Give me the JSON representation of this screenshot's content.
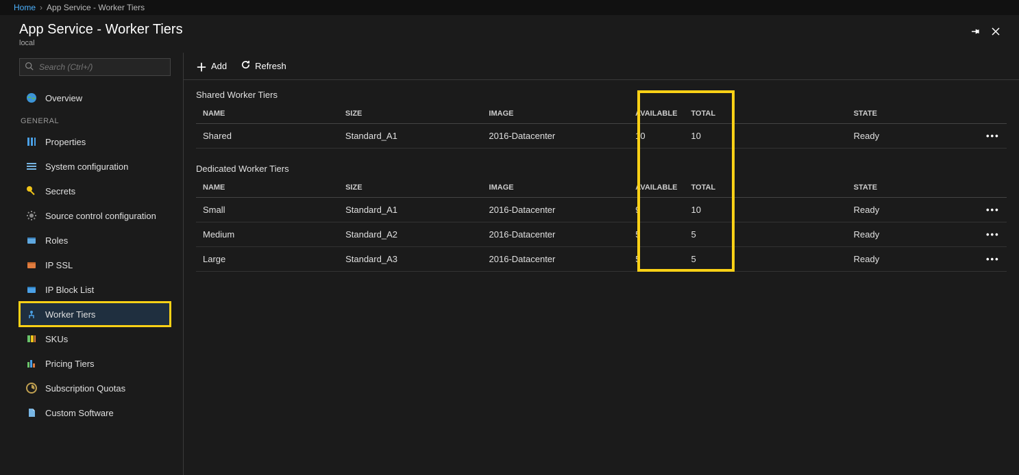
{
  "breadcrumb": {
    "home": "Home",
    "current": "App Service - Worker Tiers"
  },
  "page": {
    "title": "App Service - Worker Tiers",
    "subtitle": "local"
  },
  "search": {
    "placeholder": "Search (Ctrl+/)"
  },
  "nav": {
    "overview": "Overview",
    "section_general": "GENERAL",
    "items": {
      "properties": "Properties",
      "system_configuration": "System configuration",
      "secrets": "Secrets",
      "source_control": "Source control configuration",
      "roles": "Roles",
      "ip_ssl": "IP SSL",
      "ip_block": "IP Block List",
      "worker_tiers": "Worker Tiers",
      "skus": "SKUs",
      "pricing": "Pricing Tiers",
      "quotas": "Subscription Quotas",
      "custom_sw": "Custom Software"
    }
  },
  "toolbar": {
    "add": "Add",
    "refresh": "Refresh"
  },
  "tables": {
    "shared_title": "Shared Worker Tiers",
    "dedicated_title": "Dedicated Worker Tiers",
    "headers": {
      "name": "NAME",
      "size": "SIZE",
      "image": "IMAGE",
      "available": "AVAILABLE",
      "total": "TOTAL",
      "state": "STATE"
    },
    "shared_rows": [
      {
        "name": "Shared",
        "size": "Standard_A1",
        "image": "2016-Datacenter",
        "available": "10",
        "total": "10",
        "state": "Ready"
      }
    ],
    "dedicated_rows": [
      {
        "name": "Small",
        "size": "Standard_A1",
        "image": "2016-Datacenter",
        "available": "9",
        "total": "10",
        "state": "Ready"
      },
      {
        "name": "Medium",
        "size": "Standard_A2",
        "image": "2016-Datacenter",
        "available": "5",
        "total": "5",
        "state": "Ready"
      },
      {
        "name": "Large",
        "size": "Standard_A3",
        "image": "2016-Datacenter",
        "available": "5",
        "total": "5",
        "state": "Ready"
      }
    ]
  }
}
